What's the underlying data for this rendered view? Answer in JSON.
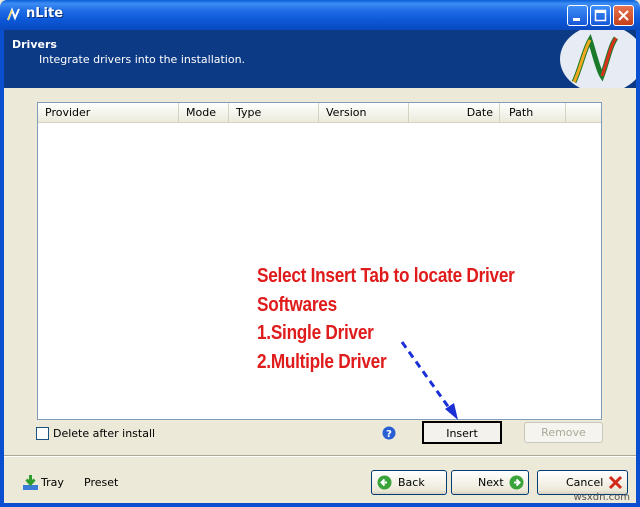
{
  "window": {
    "title": "nLite"
  },
  "header": {
    "title": "Drivers",
    "subtitle": "Integrate drivers into the installation."
  },
  "table": {
    "columns": [
      "Provider",
      "Mode",
      "Type",
      "Version",
      "Date",
      "Path"
    ],
    "rows": []
  },
  "annotation": {
    "lines": [
      "Select Insert Tab to locate Driver",
      "Softwares",
      "1.Single Driver",
      "2.Multiple Driver"
    ],
    "color": "#e01b1b"
  },
  "options": {
    "delete_after_install": "Delete after install",
    "delete_after_install_checked": false
  },
  "buttons": {
    "insert": "Insert",
    "remove": "Remove",
    "back": "Back",
    "next": "Next",
    "cancel": "Cancel"
  },
  "footer": {
    "tray": "Tray",
    "preset": "Preset"
  },
  "watermark": "wsxdn.com",
  "colors": {
    "titlebar": "#1f6ce6",
    "header_bg": "#0d3a84",
    "window_bg": "#ece9d8"
  }
}
